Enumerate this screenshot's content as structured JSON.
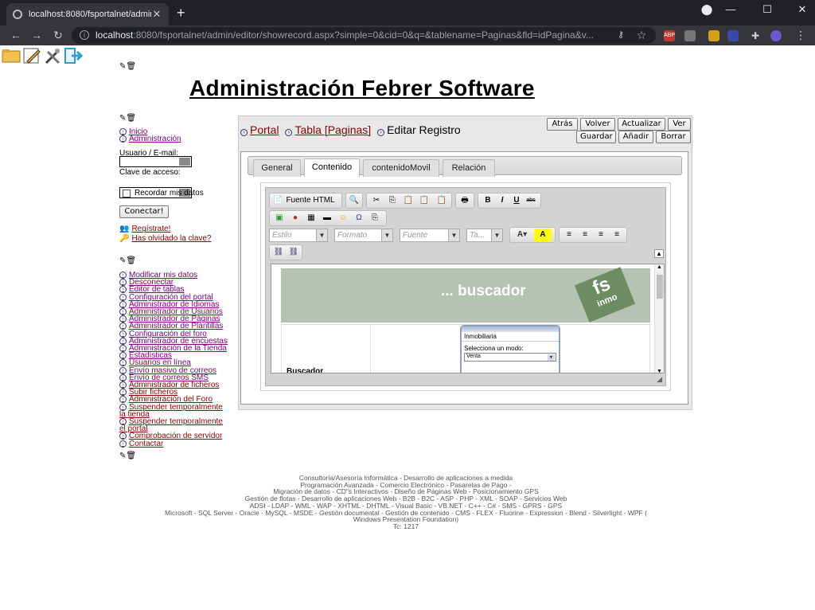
{
  "browser": {
    "tab_title": "localhost:8080/fsportalnet/admin",
    "url_host": "localhost",
    "url_rest": ":8080/fsportalnet/admin/editor/showrecord.aspx?simple=0&cid=0&q=&tablename=Paginas&fld=idPagina&v..."
  },
  "page": {
    "title": "Administración Febrer Software"
  },
  "login": {
    "items": [
      "Inicio",
      "Administración"
    ],
    "user_label": "Usuario / E-mail:",
    "password_label": "Clave de acceso:",
    "remember_label": "Recordar mis datos",
    "connect_label": "Conectar!",
    "register_label": "Regístrate!",
    "forgot_label": "Has olvidado la clave?"
  },
  "admin_menu": [
    "Modificar mis datos",
    "Desconectar",
    "Editor de tablas",
    "Configuración del portal",
    "Administrador de Idiomas",
    "Administrador de Usuarios",
    "Administrador de Páginas",
    "Administrador de Plantillas",
    "Configuración del foro",
    "Administrador de encuestas",
    "Administración de la Tienda",
    "Estadísticas",
    "Usuarios en línea",
    "Envío masivo de correos",
    "Envío de correos SMS",
    "Administrador de ficheros",
    "Subir ficheros",
    "Administración del Foro",
    "Suspender temporalmente",
    "la tienda",
    "Suspender temporalmente",
    "el portal",
    "Comprobación de servidor",
    "Contactar"
  ],
  "breadcrumb": {
    "portal": "Portal",
    "table": "Tabla [Paginas]",
    "current": "Editar Registro"
  },
  "actions": {
    "back": "Atrás",
    "return": "Volver",
    "refresh": "Actualizar",
    "view": "Ver",
    "save": "Guardar",
    "add": "Añadir",
    "delete": "Borrar"
  },
  "tabs": [
    "General",
    "Contenido",
    "contenidoMovil",
    "Relación"
  ],
  "active_tab": "Contenido",
  "editor": {
    "source_label": "Fuente HTML",
    "style_combo": "Estilo",
    "format_combo": "Formato",
    "font_combo": "Fuente",
    "size_combo": "Ta...",
    "banner_text": "... buscador",
    "logo_text": "fs",
    "logo_sub": "inmo",
    "cell_label": "Buscador",
    "widget_title": "Inmobiliaria",
    "widget_prompt": "Selecciona un modo:",
    "widget_select": "Venta"
  },
  "footer": [
    "Consultoría/Asesoría Informática - Desarrollo de aplicaciones a medida",
    "Programación Avanzada - Comercio Electrónico - Pasarelas de Pago -",
    "Migración de datos - CD\"s Interactivos - Diseño de Páginas Web - Posicionamiento GPS",
    "Gestión de flotas - Desarrollo de aplicaciones Web - B2B - B2C - ASP - PHP - XML - SOAP - Servicios Web",
    "ADSI - LDAP - WML - WAP - XHTML - DHTML - Visual Basic - VB.NET - C++ - C# - SMS - GPRS - GPS",
    "Microsoft - SQL Server - Oracle - MySQL - MSDE - Gestión documental - Gestión de contenido - CMS - FLEX - Fluorine - Expression - Blend - Silverlight - WPF (",
    "Windows Presentation Foundation)",
    "Tc: 1217"
  ]
}
